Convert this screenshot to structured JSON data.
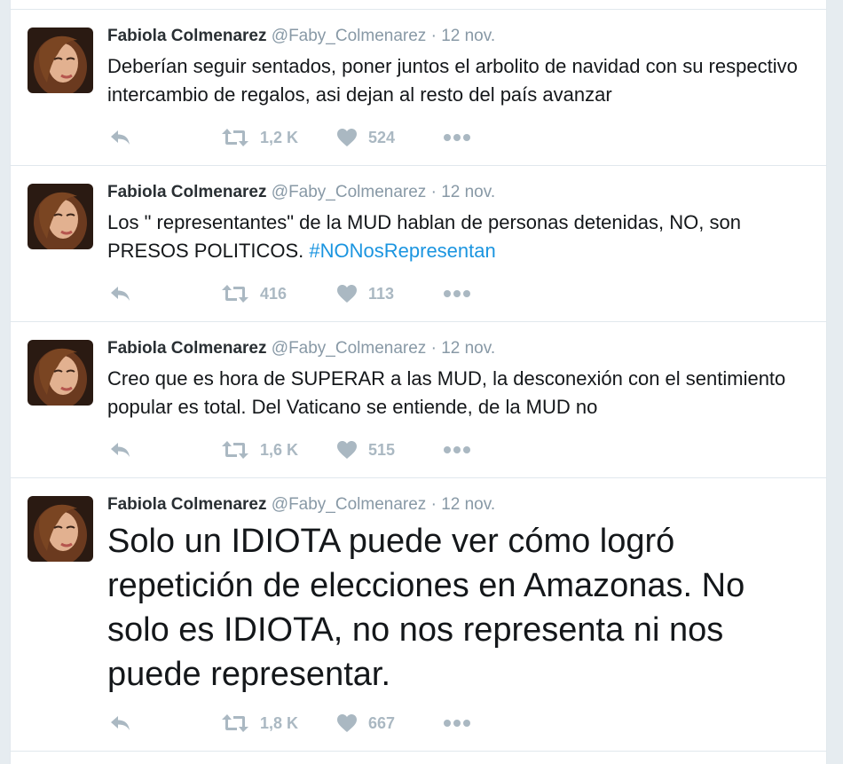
{
  "tweets": [
    {
      "name": "Fabiola Colmenarez",
      "handle": "@Faby_Colmenarez",
      "separator": "·",
      "date": "12 nov.",
      "text": "Deberían seguir sentados, poner juntos el arbolito de navidad con su respectivo intercambio de regalos, asi dejan al resto del país avanzar",
      "hashtag": "",
      "retweets": "1,2 K",
      "likes": "524"
    },
    {
      "name": "Fabiola Colmenarez",
      "handle": "@Faby_Colmenarez",
      "separator": "·",
      "date": "12 nov.",
      "text": "Los \" representantes\" de la MUD hablan de personas detenidas, NO, son PRESOS POLITICOS.",
      "hashtag": "#NONosRepresentan",
      "retweets": "416",
      "likes": "113"
    },
    {
      "name": "Fabiola Colmenarez",
      "handle": "@Faby_Colmenarez",
      "separator": "·",
      "date": "12 nov.",
      "text": "Creo que es hora de SUPERAR a las MUD, la desconexión con el sentimiento popular es total. Del Vaticano se entiende, de la MUD no",
      "hashtag": "",
      "retweets": "1,6 K",
      "likes": "515"
    },
    {
      "name": "Fabiola Colmenarez",
      "handle": "@Faby_Colmenarez",
      "separator": "·",
      "date": "12 nov.",
      "text": "Solo un IDIOTA puede ver cómo logró repetición de elecciones en Amazonas. No solo es IDIOTA, no nos representa ni nos puede representar.",
      "hashtag": "",
      "retweets": "1,8 K",
      "likes": "667"
    }
  ],
  "icons": {
    "reply": "reply-icon",
    "retweet": "retweet-icon",
    "like": "heart-icon",
    "more": "more-options-icon"
  },
  "colors": {
    "icon_gray": "#aab8c2",
    "hashtag_blue": "#1b95e0",
    "meta_gray": "#8899a6"
  }
}
